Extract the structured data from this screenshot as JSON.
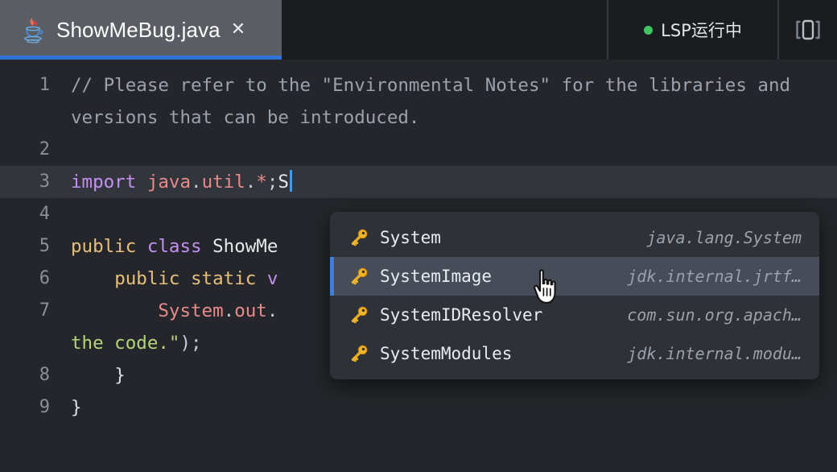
{
  "window": {
    "tab": {
      "title": "ShowMeBug.java",
      "icon": "java-icon",
      "close_label": "✕"
    },
    "status": {
      "label": "LSP运行中",
      "dot_color": "#41c463"
    },
    "layout_button_icon": "split-layout-icon"
  },
  "editor": {
    "lines": [
      {
        "number": "1",
        "segments": [
          {
            "text": "// Please refer to the \"Environmental Notes\" for the libraries and versions that can be introduced.",
            "cls": "t-comment"
          }
        ]
      },
      {
        "number": "2",
        "segments": [
          {
            "text": "",
            "cls": "t-plain"
          }
        ]
      },
      {
        "number": "3",
        "highlight": true,
        "segments": [
          {
            "text": "import",
            "cls": "t-keyword"
          },
          {
            "text": " ",
            "cls": "t-plain"
          },
          {
            "text": "java",
            "cls": "t-type"
          },
          {
            "text": ".",
            "cls": "t-punct"
          },
          {
            "text": "util",
            "cls": "t-type"
          },
          {
            "text": ".",
            "cls": "t-punct"
          },
          {
            "text": "*",
            "cls": "t-type"
          },
          {
            "text": ";",
            "cls": "t-punct"
          },
          {
            "text": "S",
            "cls": "t-ident"
          }
        ],
        "caret": true
      },
      {
        "number": "4",
        "segments": [
          {
            "text": "",
            "cls": "t-plain"
          }
        ]
      },
      {
        "number": "5",
        "segments": [
          {
            "text": "public",
            "cls": "t-keyword2"
          },
          {
            "text": " ",
            "cls": "t-plain"
          },
          {
            "text": "class",
            "cls": "t-keyword"
          },
          {
            "text": " ",
            "cls": "t-plain"
          },
          {
            "text": "ShowMe",
            "cls": "t-ident"
          }
        ]
      },
      {
        "number": "6",
        "segments": [
          {
            "text": "    ",
            "cls": "t-plain"
          },
          {
            "text": "public",
            "cls": "t-keyword2"
          },
          {
            "text": " ",
            "cls": "t-plain"
          },
          {
            "text": "static",
            "cls": "t-keyword2"
          },
          {
            "text": " ",
            "cls": "t-plain"
          },
          {
            "text": "v",
            "cls": "t-keyword"
          }
        ]
      },
      {
        "number": "7",
        "segments": [
          {
            "text": "        ",
            "cls": "t-plain"
          },
          {
            "text": "System",
            "cls": "t-type"
          },
          {
            "text": ".",
            "cls": "t-punct"
          },
          {
            "text": "out",
            "cls": "t-type"
          },
          {
            "text": ".",
            "cls": "t-punct"
          }
        ]
      },
      {
        "number": "",
        "continuation": true,
        "segments": [
          {
            "text": "the code.\"",
            "cls": "t-string"
          },
          {
            "text": ");",
            "cls": "t-punct"
          }
        ]
      },
      {
        "number": "8",
        "segments": [
          {
            "text": "    ",
            "cls": "t-plain"
          },
          {
            "text": "}",
            "cls": "t-plain"
          }
        ]
      },
      {
        "number": "9",
        "segments": [
          {
            "text": "}",
            "cls": "t-plain"
          }
        ]
      }
    ]
  },
  "autocomplete": {
    "items": [
      {
        "icon": "key-icon",
        "label": "System",
        "detail": "java.lang.System",
        "selected": false
      },
      {
        "icon": "key-icon",
        "label": "SystemImage",
        "detail": "jdk.internal.jrtf…",
        "selected": true
      },
      {
        "icon": "key-icon",
        "label": "SystemIDResolver",
        "detail": "com.sun.org.apach…",
        "selected": false
      },
      {
        "icon": "key-icon",
        "label": "SystemModules",
        "detail": "jdk.internal.modu…",
        "selected": false
      }
    ],
    "accent_color": "#3b7fe0",
    "selected_bg": "#474d58"
  },
  "pointer": {
    "type": "pointing-hand-cursor"
  }
}
